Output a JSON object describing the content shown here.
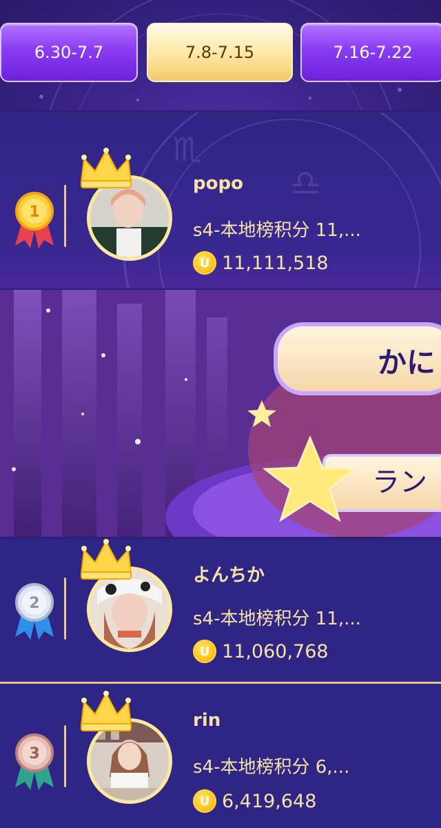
{
  "tabs": [
    {
      "label": "6.30-7.7",
      "active": false
    },
    {
      "label": "7.8-7.15",
      "active": true
    },
    {
      "label": "7.16-7.22",
      "active": false
    }
  ],
  "banner": {
    "title_fragment": "かに",
    "subtitle_fragment": "ラン"
  },
  "ranking": [
    {
      "rank": 1,
      "name": "popo",
      "score_text": "s4-本地榜积分 11,...",
      "coins": "11,111,518",
      "medal": "gold"
    },
    {
      "rank": 2,
      "name": "よんちか",
      "score_text": "s4-本地榜积分 11,...",
      "coins": "11,060,768",
      "medal": "silver"
    },
    {
      "rank": 3,
      "name": "rin",
      "score_text": "s4-本地榜积分 6,...",
      "coins": "6,419,648",
      "medal": "bronze"
    }
  ],
  "colors": {
    "accent_gold": "#f6e3a8",
    "tab_purple": "#8a3cf2",
    "tab_active": "#fde7a1",
    "card_bg": "#2e2584"
  },
  "coin_glyph": "U"
}
